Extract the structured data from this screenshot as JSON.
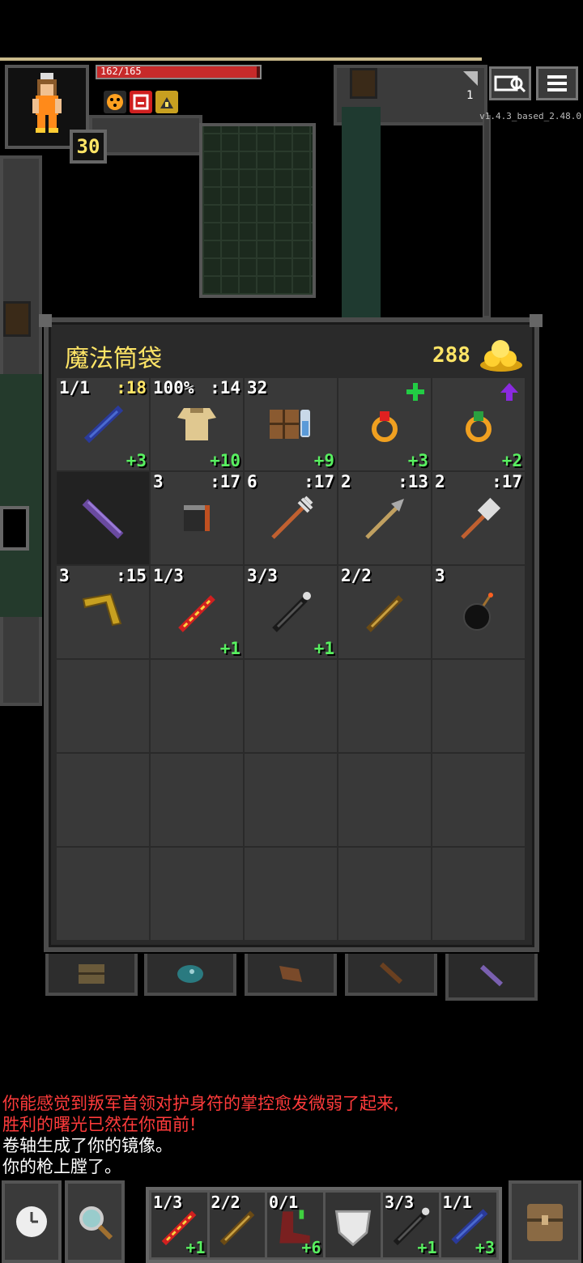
{
  "hud": {
    "hp_text": "162/165",
    "hp_fraction": 0.98,
    "hero_level": "30",
    "depth_number": "1",
    "version": "v1.4.3_based_2.48.0",
    "buff_icons": [
      "hunger-status-icon",
      "rage-status-icon",
      "haste-status-icon"
    ],
    "journal_icon": "search-journal-icon",
    "menu_icon": "menu-icon"
  },
  "bag": {
    "title": "魔法筒袋",
    "gold": "288",
    "gold_icon": "gold-pile-icon",
    "rows": [
      [
        {
          "tl": "1/1",
          "tr": ":18",
          "tr_color": "yellow",
          "br": "+3",
          "icon": "blue-wand-icon"
        },
        {
          "tl": "100%",
          "tr": ":14",
          "br": "+10",
          "icon": "cloth-armor-icon"
        },
        {
          "tl": "32",
          "tr": "",
          "br": "+9",
          "icon": "spellbook-icon"
        },
        {
          "tl": "",
          "tr": "",
          "br": "+3",
          "icon": "ruby-ring-icon",
          "mark": "green-cross-icon"
        },
        {
          "tl": "",
          "tr": "",
          "br": "+2",
          "icon": "topaz-ring-icon",
          "mark": "purple-arrow-icon"
        }
      ],
      [
        {
          "tl": "",
          "tr": "",
          "br": "",
          "icon": "purple-holster-icon",
          "dark": true
        },
        {
          "tl": "3",
          "tr": ":17",
          "br": "",
          "icon": "stone-cube-icon"
        },
        {
          "tl": "6",
          "tr": ":17",
          "br": "",
          "icon": "trident-icon"
        },
        {
          "tl": "2",
          "tr": ":13",
          "br": "",
          "icon": "javelin-icon"
        },
        {
          "tl": "2",
          "tr": ":17",
          "br": "",
          "icon": "throwing-hammer-icon"
        }
      ],
      [
        {
          "tl": "3",
          "tr": ":15",
          "br": "",
          "icon": "boomerang-icon"
        },
        {
          "tl": "1/3",
          "tr": "",
          "br": "+1",
          "icon": "fire-wand-icon"
        },
        {
          "tl": "3/3",
          "tr": "",
          "br": "+1",
          "icon": "black-wand-icon"
        },
        {
          "tl": "2/2",
          "tr": "",
          "br": "",
          "icon": "wooden-wand-icon"
        },
        {
          "tl": "3",
          "tr": "",
          "br": "",
          "icon": "bomb-icon"
        }
      ]
    ],
    "empty_slots": 15,
    "tabs": [
      "backpack-tab-icon",
      "seed-pouch-tab-icon",
      "scroll-holder-tab-icon",
      "potion-bandolier-tab-icon",
      "wand-holster-tab-icon"
    ]
  },
  "log": [
    {
      "text": "你能感觉到叛军首领对护身符的掌控愈发微弱了起来,",
      "color": "#ff3b3b"
    },
    {
      "text": "胜利的曙光已然在你面前!",
      "color": "#ff3b3b"
    },
    {
      "text": "卷轴生成了你的镜像。",
      "color": "#ffffff"
    },
    {
      "text": "你的枪上膛了。",
      "color": "#ffffff"
    }
  ],
  "toolbar": {
    "wait_icon": "clock-icon",
    "search_icon": "magnifier-icon",
    "inventory_icon": "backpack-icon",
    "quickslots": [
      {
        "tl": "1/3",
        "br": "+1",
        "icon": "fire-wand-icon"
      },
      {
        "tl": "2/2",
        "br": "",
        "icon": "wooden-wand-icon"
      },
      {
        "tl": "0/1",
        "br": "+6",
        "icon": "red-boots-icon"
      },
      {
        "tl": "",
        "br": "",
        "icon": "shield-icon"
      },
      {
        "tl": "3/3",
        "br": "+1",
        "icon": "black-wand-icon"
      },
      {
        "tl": "1/1",
        "br": "+3",
        "icon": "blue-wand-icon"
      }
    ]
  }
}
